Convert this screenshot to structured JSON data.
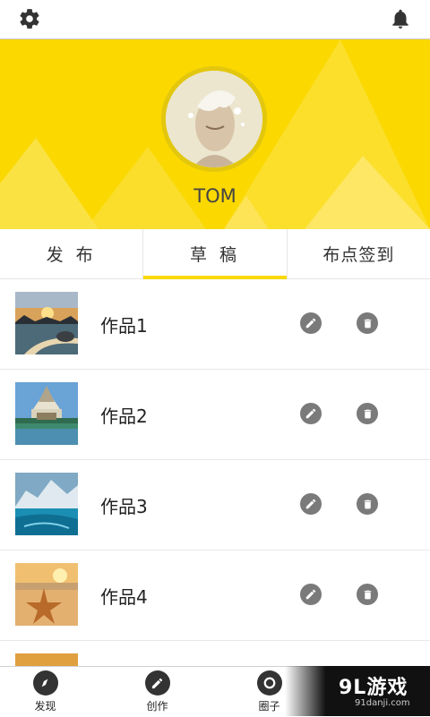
{
  "topbar": {
    "settings_icon": "gear-icon",
    "notify_icon": "bell-icon"
  },
  "profile": {
    "username": "TOM"
  },
  "tabs": [
    {
      "label": "发 布",
      "active": false
    },
    {
      "label": "草 稿",
      "active": true
    },
    {
      "label": "布点签到",
      "active": false
    }
  ],
  "works": [
    {
      "title": "作品1",
      "thumb": "sunset-rocks-beach"
    },
    {
      "title": "作品2",
      "thumb": "thai-temple"
    },
    {
      "title": "作品3",
      "thumb": "glacier-water"
    },
    {
      "title": "作品4",
      "thumb": "starfish-sand"
    }
  ],
  "bottom_nav": [
    {
      "label": "发现",
      "icon": "compass-icon"
    },
    {
      "label": "创作",
      "icon": "pencil-icon"
    },
    {
      "label": "圈子",
      "icon": "circle-icon"
    }
  ],
  "watermark": {
    "main": "9L游戏",
    "sub": "91danji.com"
  },
  "colors": {
    "accent": "#fad800",
    "icon_grey": "#7a7a7a"
  }
}
